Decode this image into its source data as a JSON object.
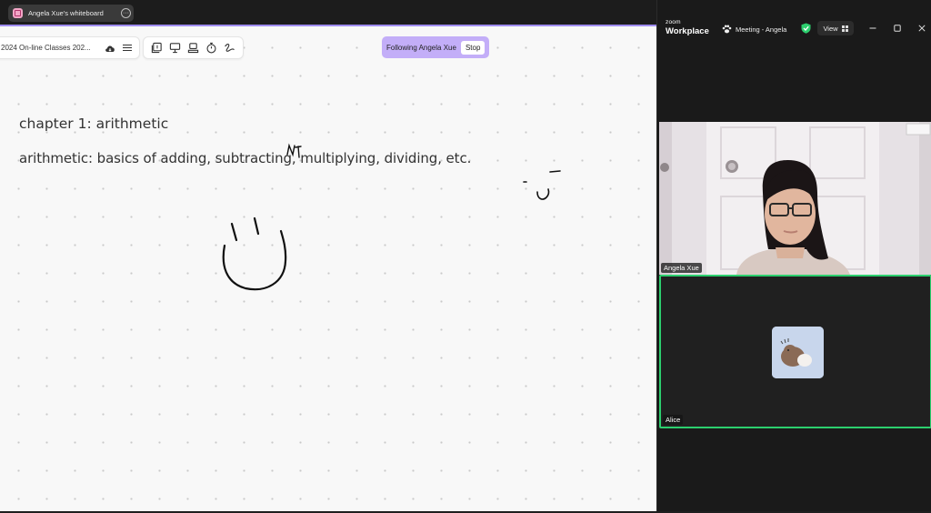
{
  "browser": {
    "tab_title": "Angela Xue's whiteboard",
    "tab_menu_glyph": "···"
  },
  "whiteboard": {
    "file_title": "2024 On-line Classes 202...",
    "icons": {
      "cloud": "cloud-sync-icon",
      "menu": "hamburger-menu-icon",
      "tools": [
        "page-number-icon",
        "presentation-icon",
        "stamp-icon",
        "timer-icon",
        "pen-hand-icon"
      ]
    },
    "following_text": "Following Angela Xue",
    "stop_label": "Stop",
    "accent_color": "#9f8cf0",
    "content": {
      "chapter": "chapter 1: arithmetic",
      "definition": "arithmetic: basics of adding, subtracting, multiplying, dividing, etc."
    }
  },
  "zoom": {
    "logo_small": "zoom",
    "logo_big": "Workplace",
    "meeting_title": "Meeting - Angela",
    "view_label": "View",
    "participants": [
      {
        "name": "Angela Xue"
      },
      {
        "name": "Alice"
      }
    ],
    "active_speaker_color": "#2ccf6e"
  }
}
